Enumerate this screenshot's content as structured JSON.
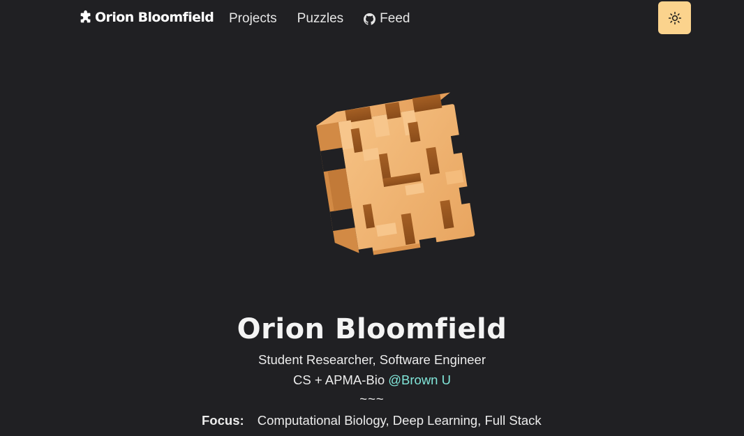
{
  "nav": {
    "brand": "Orion Bloomfield",
    "brand_icon": "puzzle-piece-icon",
    "links": [
      {
        "label": "Projects"
      },
      {
        "label": "Puzzles"
      },
      {
        "label": "Feed",
        "icon": "github-icon"
      }
    ],
    "theme_toggle_icon": "sun-icon"
  },
  "hero": {
    "icon": "wooden-puzzle-cube"
  },
  "intro": {
    "name": "Orion Bloomfield",
    "role": "Student Researcher, Software Engineer",
    "study_prefix": "CS + APMA-Bio",
    "study_link": "@Brown U",
    "separator": "~~~",
    "focus_label": "Focus:",
    "focus_value": "Computational Biology, Deep Learning, Full Stack"
  },
  "colors": {
    "background": "#202023",
    "accent_link": "#81e6d9",
    "toggle_bg": "#fbd38d",
    "wood_light": "#f0b070",
    "wood_dark": "#9c5a22"
  }
}
